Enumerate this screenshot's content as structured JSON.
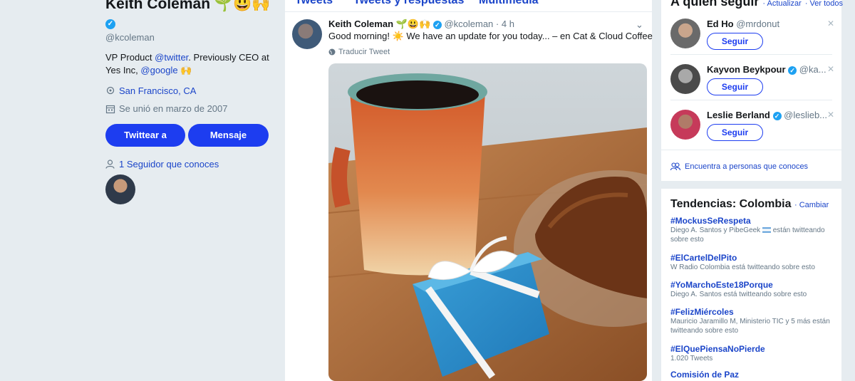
{
  "profile": {
    "name": "Keith Coleman",
    "emoji": "🌱😃🙌",
    "handle": "@kcoleman",
    "bio_prefix": "VP Product ",
    "bio_link1": "@twitter",
    "bio_middle": ". Previously CEO at Yes Inc, ",
    "bio_link2": "@google",
    "bio_emoji": "🙌",
    "location": "San Francisco, CA",
    "joined": "Se unió en marzo de 2007",
    "tweet_to_button": "Twittear a",
    "message_button": "Mensaje",
    "followers_you_know": "1 Seguidor que conoces"
  },
  "tabs": [
    "Tweets",
    "Tweets y respuestas",
    "Multimedia"
  ],
  "tweet": {
    "name": "Keith Coleman",
    "emoji": "🌱😃🙌",
    "handle": "@kcoleman",
    "time": "· 4 h",
    "text": "Good morning! ☀️ We have an update for you today... – en Cat & Cloud Coffee",
    "translate": "Traducir Tweet"
  },
  "who_to_follow": {
    "title": "A quién seguir",
    "refresh": "· Actualizar",
    "view_all": "· Ver todos",
    "follow_label": "Seguir",
    "users": [
      {
        "name": "Ed Ho",
        "handle": "@mrdonut",
        "verified": false
      },
      {
        "name": "Kayvon Beykpour",
        "handle": "@ka...",
        "verified": true
      },
      {
        "name": "Leslie Berland",
        "handle": "@leslieb...",
        "verified": true
      }
    ],
    "find_people": "Encuentra a personas que conoces"
  },
  "trends": {
    "title": "Tendencias: Colombia",
    "change": "· Cambiar",
    "items": [
      {
        "tag": "#MockusSeRespeta",
        "sub_a": "Diego A. Santos y PibeGeek",
        "sub_b": " están twitteando sobre esto"
      },
      {
        "tag": "#ElCartelDelPito",
        "sub_a": "W Radio Colombia está twitteando sobre esto",
        "sub_b": ""
      },
      {
        "tag": "#YoMarchoEste18Porque",
        "sub_a": "Diego A. Santos está twitteando sobre esto",
        "sub_b": ""
      },
      {
        "tag": "#FelizMiércoles",
        "sub_a": "Mauricio Jaramillo M, Ministerio TIC y 5 más están twitteando sobre esto",
        "sub_b": ""
      },
      {
        "tag": "#ElQuePiensaNoPierde",
        "sub_a": "1.020 Tweets",
        "sub_b": ""
      },
      {
        "tag": "Comisión de Paz",
        "sub_a": "",
        "sub_b": ""
      }
    ]
  },
  "colors": {
    "accent": "#1d3df0",
    "link": "#1b45c9",
    "verified": "#1da1f2",
    "background": "#e6ecf0"
  }
}
